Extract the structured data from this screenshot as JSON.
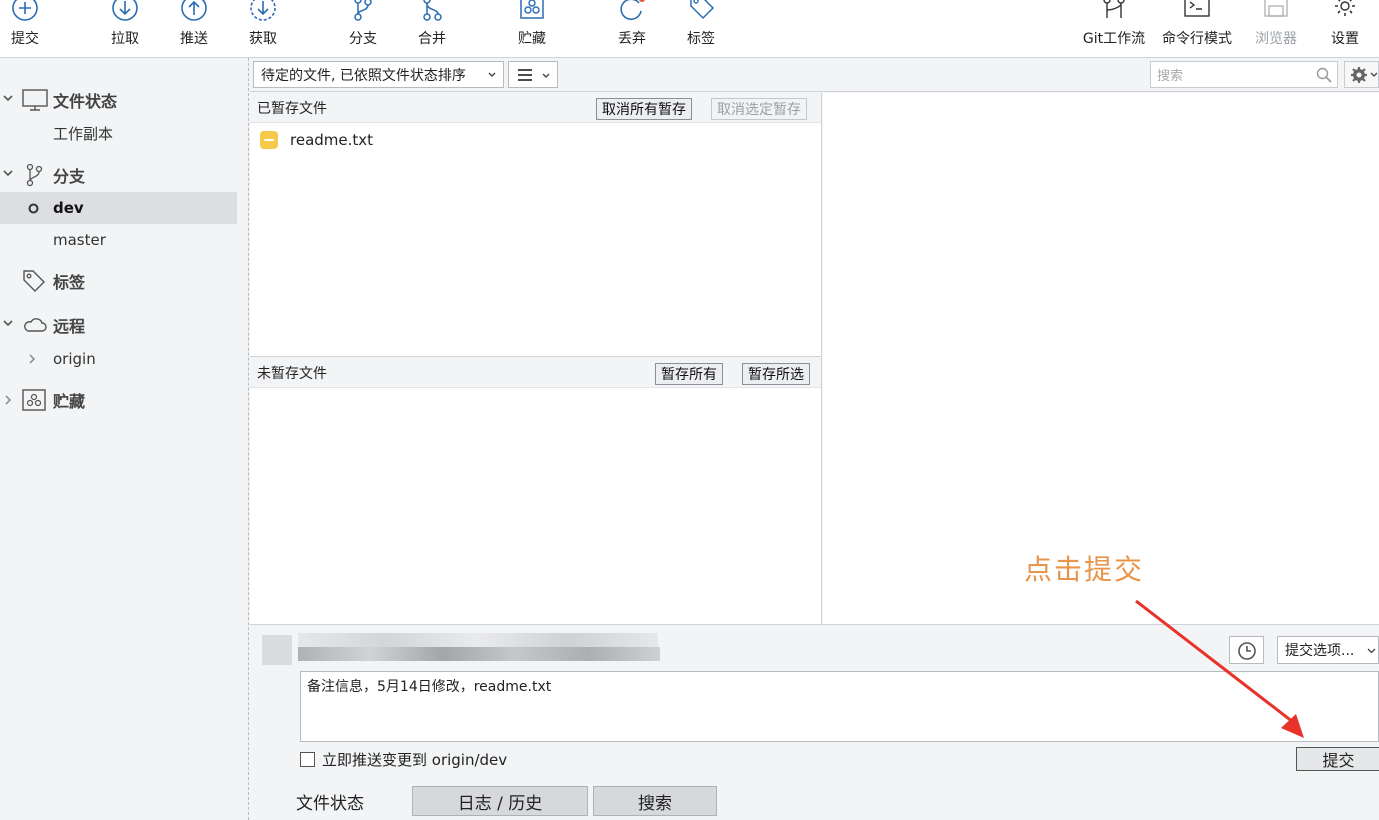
{
  "toolbar": {
    "commit": "提交",
    "pull": "拉取",
    "push": "推送",
    "fetch": "获取",
    "branch": "分支",
    "merge": "合并",
    "stash": "贮藏",
    "discard": "丢弃",
    "tag": "标签",
    "git_flow": "Git工作流",
    "terminal": "命令行模式",
    "browser": "浏览器",
    "settings": "设置"
  },
  "sidebar": {
    "file_status": "文件状态",
    "working_copy": "工作副本",
    "branches": "分支",
    "branch_items": [
      "dev",
      "master"
    ],
    "tags": "标签",
    "remotes": "远程",
    "remote_items": [
      "origin"
    ],
    "stashes": "贮藏"
  },
  "filterbar": {
    "sort_select": "待定的文件, 已依照文件状态排序",
    "search_placeholder": "搜索"
  },
  "staged": {
    "title": "已暂存文件",
    "unstage_all": "取消所有暂存",
    "unstage_selected": "取消选定暂存",
    "files": [
      "readme.txt"
    ]
  },
  "unstaged": {
    "title": "未暂存文件",
    "stage_all": "暂存所有",
    "stage_selected": "暂存所选"
  },
  "commit": {
    "options": "提交选项...",
    "message": "备注信息，5月14日修改，readme.txt",
    "push_checkbox": "立即推送变更到 origin/dev",
    "push_checked": false,
    "button": "提交"
  },
  "tabs": [
    "文件状态",
    "日志 / 历史",
    "搜索"
  ],
  "annotation": {
    "text": "点击提交",
    "color": "#e8944a",
    "arrow_color": "#e8322a"
  }
}
